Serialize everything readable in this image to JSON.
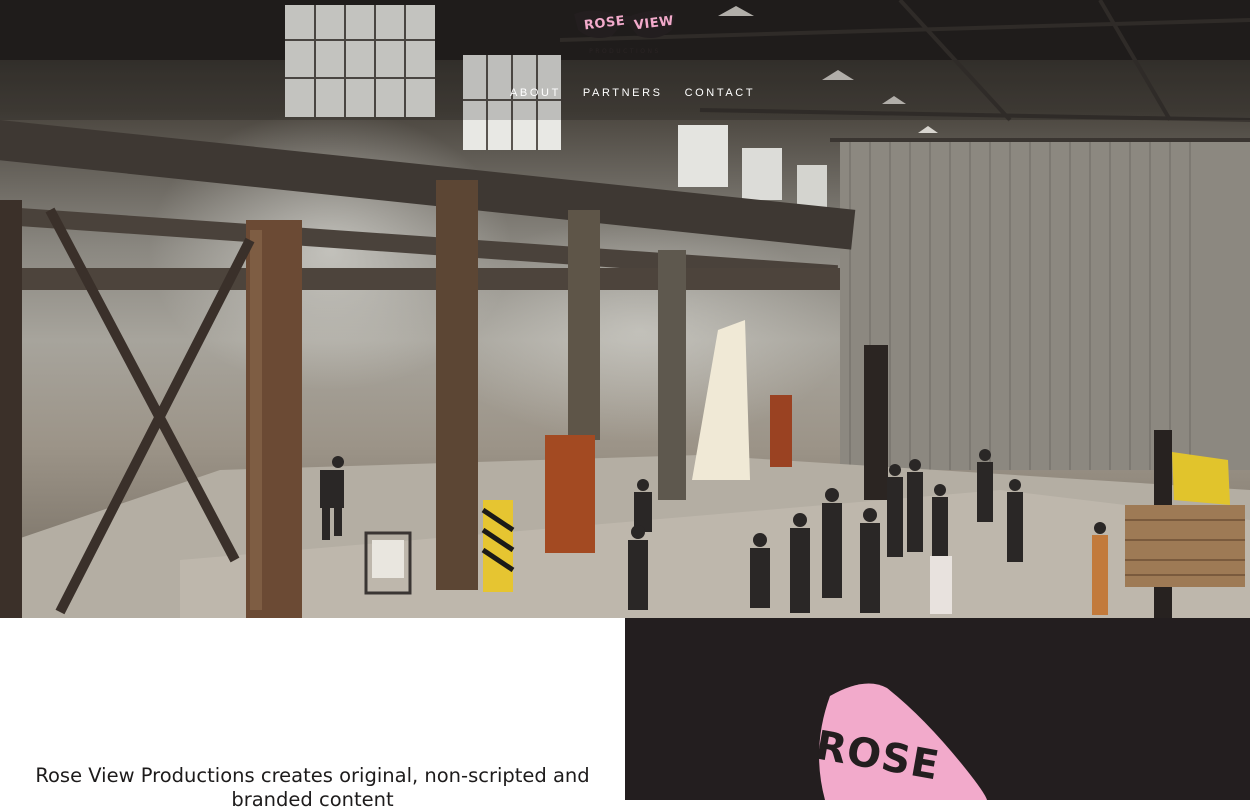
{
  "brand": {
    "word_left": "ROSE",
    "word_right": "VIEW",
    "subtitle": "PRODUCTIONS",
    "pink": "#f2aacb",
    "dark": "#231e1f"
  },
  "nav": {
    "items": [
      {
        "label": "ABOUT"
      },
      {
        "label": "PARTNERS"
      },
      {
        "label": "CONTACT"
      }
    ]
  },
  "hero": {
    "image": "warehouse-film-set-photo"
  },
  "about": {
    "tagline": "Rose View Productions creates original, non-scripted and branded content"
  },
  "feature": {
    "word": "ROSE"
  }
}
